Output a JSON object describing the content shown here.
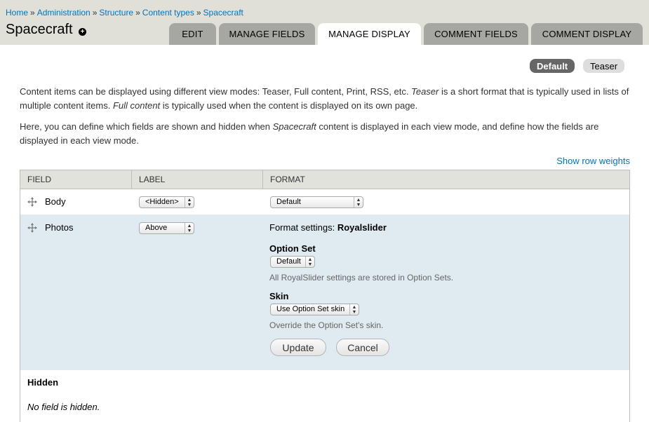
{
  "breadcrumb": [
    {
      "label": "Home"
    },
    {
      "label": "Administration"
    },
    {
      "label": "Structure"
    },
    {
      "label": "Content types"
    },
    {
      "label": "Spacecraft"
    }
  ],
  "breadcrumb_separator": "»",
  "page_title": "Spacecraft",
  "tabs": [
    {
      "label": "Edit",
      "active": false
    },
    {
      "label": "Manage fields",
      "active": false
    },
    {
      "label": "Manage display",
      "active": true
    },
    {
      "label": "Comment fields",
      "active": false
    },
    {
      "label": "Comment display",
      "active": false
    }
  ],
  "view_modes": [
    {
      "label": "Default",
      "active": true
    },
    {
      "label": "Teaser",
      "active": false
    }
  ],
  "description": {
    "p1_a": "Content items can be displayed using different view modes: Teaser, Full content, Print, RSS, etc. ",
    "p1_em1": "Teaser",
    "p1_b": " is a short format that is typically used in lists of multiple content items. ",
    "p1_em2": "Full content",
    "p1_c": " is typically used when the content is displayed on its own page.",
    "p2_a": "Here, you can define which fields are shown and hidden when ",
    "p2_em": "Spacecraft",
    "p2_b": " content is displayed in each view mode, and define how the fields are displayed in each view mode."
  },
  "show_row_weights": "Show row weights",
  "table": {
    "headers": {
      "field": "Field",
      "label": "Label",
      "format": "Format"
    },
    "rows": [
      {
        "field": "Body",
        "label_select": "<Hidden>",
        "format_select": "Default"
      },
      {
        "field": "Photos",
        "label_select": "Above"
      }
    ]
  },
  "format_settings": {
    "title_prefix": "Format settings:",
    "title_value": "Royalslider",
    "option_set_label": "Option Set",
    "option_set_value": "Default",
    "option_set_help": "All RoyalSlider settings are stored in Option Sets.",
    "skin_label": "Skin",
    "skin_value": "Use Option Set skin",
    "skin_help": "Override the Option Set's skin.",
    "update_button": "Update",
    "cancel_button": "Cancel"
  },
  "hidden_section": {
    "title": "Hidden",
    "empty_text": "No field is hidden."
  },
  "colors": {
    "header_bg": "#e0e0d8",
    "tab_bg": "#a6a7a2",
    "link": "#0074bd",
    "row_highlight": "#dfeaf1"
  },
  "icons": {
    "drag_handle": "drag-handle-icon",
    "add_shortcut": "add-shortcut-icon"
  }
}
